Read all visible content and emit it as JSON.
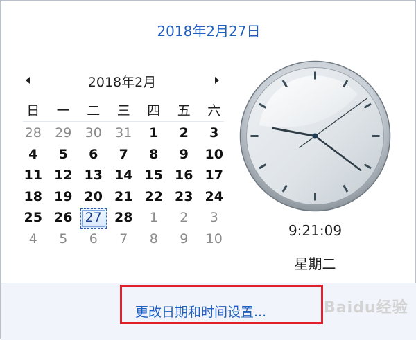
{
  "header": {
    "date_text": "2018年2月27日"
  },
  "calendar": {
    "month_title": "2018年2月",
    "weekdays": [
      "日",
      "一",
      "二",
      "三",
      "四",
      "五",
      "六"
    ],
    "weeks": [
      [
        {
          "d": "28",
          "o": true
        },
        {
          "d": "29",
          "o": true
        },
        {
          "d": "30",
          "o": true
        },
        {
          "d": "31",
          "o": true
        },
        {
          "d": "1"
        },
        {
          "d": "2"
        },
        {
          "d": "3"
        }
      ],
      [
        {
          "d": "4"
        },
        {
          "d": "5"
        },
        {
          "d": "6"
        },
        {
          "d": "7"
        },
        {
          "d": "8"
        },
        {
          "d": "9"
        },
        {
          "d": "10"
        }
      ],
      [
        {
          "d": "11"
        },
        {
          "d": "12"
        },
        {
          "d": "13"
        },
        {
          "d": "14"
        },
        {
          "d": "15"
        },
        {
          "d": "16"
        },
        {
          "d": "17"
        }
      ],
      [
        {
          "d": "18"
        },
        {
          "d": "19"
        },
        {
          "d": "20"
        },
        {
          "d": "21"
        },
        {
          "d": "22"
        },
        {
          "d": "23"
        },
        {
          "d": "24"
        }
      ],
      [
        {
          "d": "25"
        },
        {
          "d": "26"
        },
        {
          "d": "27",
          "today": true
        },
        {
          "d": "28"
        },
        {
          "d": "1",
          "o": true
        },
        {
          "d": "2",
          "o": true
        },
        {
          "d": "3",
          "o": true
        }
      ],
      [
        {
          "d": "4",
          "o": true
        },
        {
          "d": "5",
          "o": true
        },
        {
          "d": "6",
          "o": true
        },
        {
          "d": "7",
          "o": true
        },
        {
          "d": "8",
          "o": true
        },
        {
          "d": "9",
          "o": true
        },
        {
          "d": "10",
          "o": true
        }
      ]
    ]
  },
  "clock": {
    "hour": 9,
    "minute": 21,
    "second": 9,
    "time_text": "9:21:09",
    "weekday_text": "星期二"
  },
  "footer": {
    "settings_link": "更改日期和时间设置..."
  },
  "watermark": {
    "text": "Baidu经验"
  },
  "colors": {
    "link": "#1e5fbf",
    "highlight_box": "#e0202a",
    "today_border": "#2a5fb3"
  },
  "icons": {
    "prev": "triangle-left-icon",
    "next": "triangle-right-icon"
  }
}
